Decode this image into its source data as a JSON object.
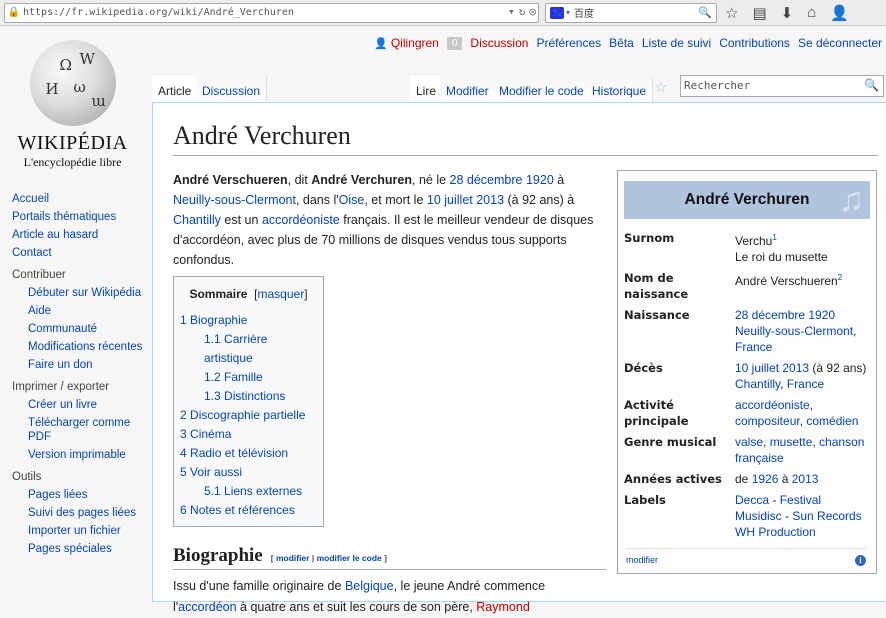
{
  "browser": {
    "url": "https://fr.wikipedia.org/wiki/André_Verchuren",
    "search_engine_label": "百度",
    "search_engine_icon": "baidu-paw-icon"
  },
  "personal": {
    "username": "Qilingren",
    "notifications": "0",
    "discussion": "Discussion",
    "preferences": "Préférences",
    "beta": "Bêta",
    "watchlist": "Liste de suivi",
    "contributions": "Contributions",
    "logout": "Se déconnecter"
  },
  "logo": {
    "wordmark": "WIKIPÉDIA",
    "tagline": "L'encyclopédie libre"
  },
  "sidebar": {
    "main": [
      "Accueil",
      "Portails thématiques",
      "Article au hasard",
      "Contact"
    ],
    "contribute_heading": "Contribuer",
    "contribute": [
      "Débuter sur Wikipédia",
      "Aide",
      "Communauté",
      "Modifications récentes",
      "Faire un don"
    ],
    "print_heading": "Imprimer / exporter",
    "print": [
      "Créer un livre",
      "Télécharger comme PDF",
      "Version imprimable"
    ],
    "tools_heading": "Outils",
    "tools": [
      "Pages liées",
      "Suivi des pages liées",
      "Importer un fichier",
      "Pages spéciales"
    ]
  },
  "tabs": {
    "article": "Article",
    "discussion": "Discussion",
    "read": "Lire",
    "edit": "Modifier",
    "edit_source": "Modifier le code",
    "history": "Historique",
    "search_placeholder": "Rechercher"
  },
  "article": {
    "title": "André Verchuren",
    "intro": {
      "name1": "André Verschueren",
      "t1": ", dit ",
      "name2": "André Verchuren",
      "t2": ", né le ",
      "birth_date": "28 décembre 1920",
      "t3": " à ",
      "birth_place": "Neuilly-sous-Clermont",
      "t4": ", dans l'",
      "dept": "Oise",
      "t5": ", et mort le ",
      "death_date": "10 juillet 2013",
      "t6": " (à 92 ans) à ",
      "death_place": "Chantilly",
      "t7": " est un ",
      "profession": "accordéoniste",
      "t8": " français. Il est le meilleur vendeur de disques d'accordéon, avec plus de 70 millions de disques vendus tous supports confondus."
    },
    "toc": {
      "title": "Sommaire",
      "hide": "masquer",
      "items": [
        {
          "num": "1",
          "label": "Biographie",
          "level": 1
        },
        {
          "num": "1.1",
          "label": "Carrière artistique",
          "level": 2
        },
        {
          "num": "1.2",
          "label": "Famille",
          "level": 2
        },
        {
          "num": "1.3",
          "label": "Distinctions",
          "level": 2
        },
        {
          "num": "2",
          "label": "Discographie partielle",
          "level": 1
        },
        {
          "num": "3",
          "label": "Cinéma",
          "level": 1
        },
        {
          "num": "4",
          "label": "Radio et télévision",
          "level": 1
        },
        {
          "num": "5",
          "label": "Voir aussi",
          "level": 1
        },
        {
          "num": "5.1",
          "label": "Liens externes",
          "level": 2
        },
        {
          "num": "6",
          "label": "Notes et références",
          "level": 1
        }
      ]
    },
    "bio": {
      "heading": "Biographie",
      "edit": "modifier",
      "edit_source": "modifier le code",
      "t1": "Issu d'une famille originaire de ",
      "country": "Belgique",
      "t2": ", le jeune André commence l'",
      "instrument": "accordéon",
      "t3": " à quatre ans et suit les cours de son père, ",
      "father": "Raymond"
    }
  },
  "infobox": {
    "title": "André Verchuren",
    "foot": "modifier",
    "rows": {
      "nickname_label": "Surnom",
      "nickname_1": "Verchu",
      "nickname_sup": "1",
      "nickname_2": "Le roi du musette",
      "birthname_label": "Nom de naissance",
      "birthname": "André Verschueren",
      "birthname_sup": "2",
      "birth_label": "Naissance",
      "birth_date": "28 décembre 1920",
      "birth_place": "Neuilly-sous-Clermont",
      "birth_country": "France",
      "death_label": "Décès",
      "death_date": "10 juillet 2013",
      "death_age": " (à 92 ans)",
      "death_place": "Chantilly",
      "death_country": "France",
      "activity_label": "Activité principale",
      "activity_1": "accordéoniste",
      "activity_2": "compositeur",
      "activity_3": "comédien",
      "genre_label": "Genre musical",
      "genre_1": "valse",
      "genre_2": "musette",
      "genre_3": "chanson française",
      "years_label": "Années actives",
      "years_from_word": "de ",
      "years_from": "1926",
      "years_to_word": " à ",
      "years_to": "2013",
      "labels_label": "Labels",
      "labels_1": "Decca",
      "labels_2": "Festival",
      "labels_3": "Musidisc",
      "labels_4": "Sun Records",
      "labels_5": "WH Production"
    }
  }
}
